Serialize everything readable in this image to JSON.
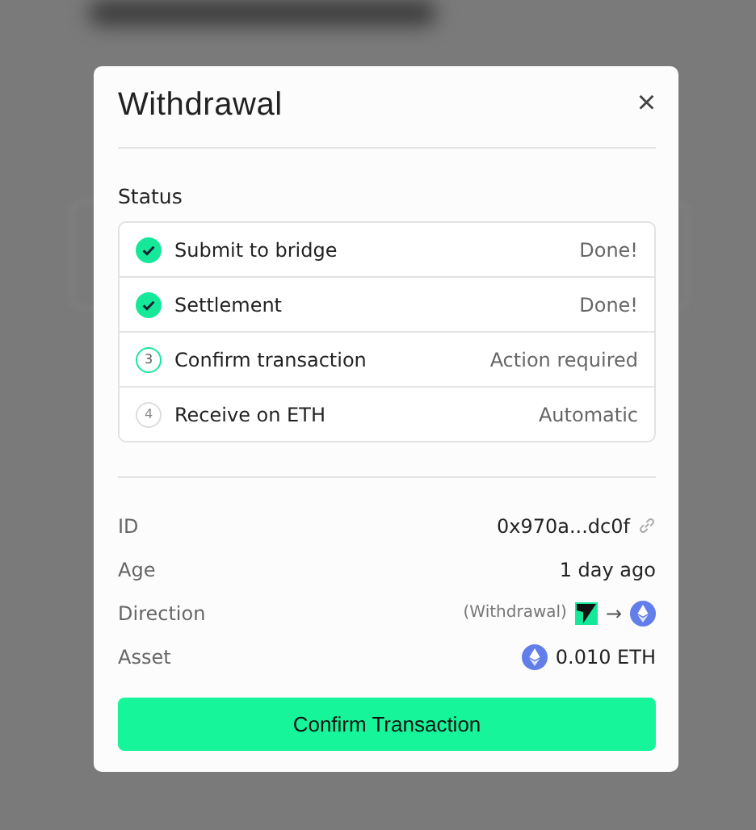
{
  "dialog": {
    "title": "Withdrawal",
    "close_icon": "×"
  },
  "status": {
    "heading": "Status",
    "steps": [
      {
        "kind": "done",
        "label": "Submit to bridge",
        "state_text": "Done!"
      },
      {
        "kind": "done",
        "label": "Settlement",
        "state_text": "Done!"
      },
      {
        "kind": "current",
        "number": "3",
        "label": "Confirm transaction",
        "state_text": "Action required"
      },
      {
        "kind": "pending",
        "number": "4",
        "label": "Receive on ETH",
        "state_text": "Automatic"
      }
    ]
  },
  "details": [
    {
      "kind": "id",
      "label": "ID",
      "value": "0x970a...dc0f"
    },
    {
      "kind": "text",
      "label": "Age",
      "value": "1 day ago"
    },
    {
      "kind": "direction",
      "label": "Direction",
      "value": "(Withdrawal)",
      "arrow": "→"
    },
    {
      "kind": "asset",
      "label": "Asset",
      "value": "0.010 ETH"
    }
  ],
  "button": {
    "label": "Confirm Transaction"
  }
}
